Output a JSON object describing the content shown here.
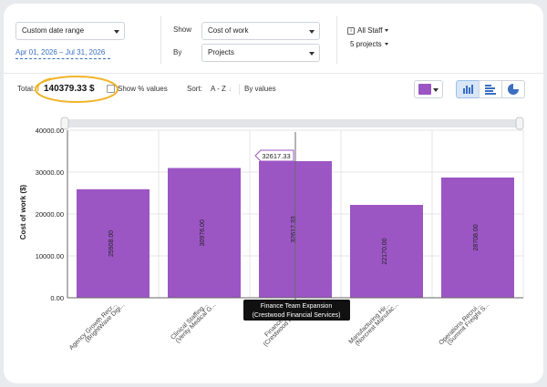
{
  "filters": {
    "date_range_label": "Custom date range",
    "date_from": "Apr 01, 2026",
    "date_sep": "–",
    "date_to": "Jul 31, 2026",
    "show_label": "Show",
    "show_value": "Cost of work",
    "by_label": "By",
    "by_value": "Projects",
    "staff_label": "All Staff",
    "projects_label": "5 projects"
  },
  "toolbar": {
    "total_label": "Total:",
    "total_value": "140379.33 $",
    "show_percent_label": "Show % values",
    "sort_label": "Sort:",
    "sort_az": "A - Z",
    "sort_az_arrow": "↓",
    "sort_by_values": "By values",
    "accent_color": "#9b56c4",
    "view_buttons": [
      "bar-chart-icon",
      "horizontal-bar-chart-icon",
      "pie-chart-icon"
    ]
  },
  "tooltip": {
    "value": "32617.33",
    "category_line1": "Finance Team Expansion",
    "category_line2": "(Crestwood Financial Services)"
  },
  "chart_data": {
    "type": "bar",
    "ylabel": "Cost of work ($)",
    "ylim": [
      0,
      40000
    ],
    "yticks": [
      "0.00",
      "10000.00",
      "20000.00",
      "30000.00",
      "40000.00"
    ],
    "grid": true,
    "bar_color": "#9b56c4",
    "categories": [
      [
        "Agency Growth Recr...",
        "(BrightWave Digi..."
      ],
      [
        "Clinical Staffing...",
        "(Verity Medical G..."
      ],
      [
        "Finance Team...",
        "(Crestwood Financ..."
      ],
      [
        "Manufacturing Hir...",
        "(Norcrest Manufac..."
      ],
      [
        "Operations Recrui...",
        "(Summit Freight S..."
      ]
    ],
    "values": [
      25908.0,
      30976.0,
      32617.33,
      22170.0,
      28708.0
    ],
    "value_labels": [
      "25908.00",
      "30976.00",
      "32617.33",
      "22170.00",
      "28708.00"
    ]
  }
}
